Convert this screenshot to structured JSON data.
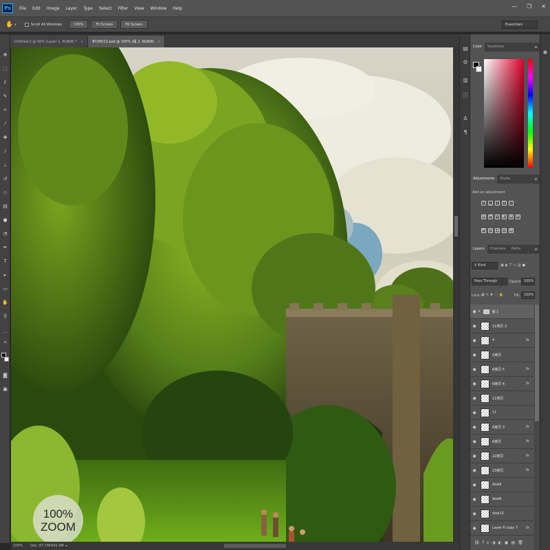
{
  "app": {
    "logo": "Ps"
  },
  "menu": [
    "File",
    "Edit",
    "Image",
    "Layer",
    "Type",
    "Select",
    "Filter",
    "View",
    "Window",
    "Help"
  ],
  "window_controls": {
    "minimize": "—",
    "restore": "❐",
    "close": "✕"
  },
  "options_bar": {
    "tool_icon": "hand-icon",
    "scroll_all_windows": "Scroll All Windows",
    "btn_100": "100%",
    "btn_fit": "Fit Screen",
    "btn_fill": "Fill Screen",
    "workspace": "Essentials"
  },
  "tabs": [
    {
      "label": "Untitled-1 @ 50% (Layer 1, RGB/8) *",
      "close": "×",
      "active": false
    },
    {
      "label": "B7/06/12.psd @ 100% (组 2, RGB/8)",
      "close": "×",
      "active": true
    }
  ],
  "canvas": {
    "overlay_line1": "100%",
    "overlay_line2": "ZOOM"
  },
  "status_bar": {
    "zoom": "100%",
    "doc": "Doc: 87.1M/642.4M"
  },
  "color_panel": {
    "tabs": [
      "Color",
      "Swatches"
    ]
  },
  "adjustments_panel": {
    "tabs": [
      "Adjustments",
      "Styles"
    ],
    "add_label": "Add an adjustment"
  },
  "layers_panel": {
    "tabs": [
      "Layers",
      "Channels",
      "Paths"
    ],
    "filter_kind": "Kind",
    "blend_mode": "Pass Through",
    "opacity_label": "Opacity:",
    "opacity_value": "100%",
    "lock_label": "Lock:",
    "fill_label": "Fill:",
    "fill_value": "100%",
    "layers": [
      {
        "name": "组 1",
        "group": true,
        "fx": ""
      },
      {
        "name": "11拷贝 2",
        "group": false,
        "fx": ""
      },
      {
        "name": "4",
        "group": false,
        "fx": "fx"
      },
      {
        "name": "5拷贝",
        "group": false,
        "fx": ""
      },
      {
        "name": "6拷贝 5",
        "group": false,
        "fx": "fx"
      },
      {
        "name": "6拷贝 4",
        "group": false,
        "fx": "fx"
      },
      {
        "name": "11拷贝",
        "group": false,
        "fx": ""
      },
      {
        "name": "11",
        "group": false,
        "fx": ""
      },
      {
        "name": "6拷贝 3",
        "group": false,
        "fx": "fx"
      },
      {
        "name": "6拷贝",
        "group": false,
        "fx": "fx"
      },
      {
        "name": "22拷贝",
        "group": false,
        "fx": "fx"
      },
      {
        "name": "23拷贝",
        "group": false,
        "fx": "fx"
      },
      {
        "name": "dow6",
        "group": false,
        "fx": ""
      },
      {
        "name": "dow6",
        "group": false,
        "fx": ""
      },
      {
        "name": "dow13",
        "group": false,
        "fx": ""
      },
      {
        "name": "Layer 6 copy 7",
        "group": false,
        "fx": "fx"
      }
    ],
    "bottom_icons": [
      "⛓",
      "fx",
      "◑",
      "◐",
      "▣",
      "▤",
      "🗑"
    ]
  },
  "colors": {
    "menubar": "#535353",
    "panel": "#535353",
    "dark": "#282828",
    "accent": "#31a8ff"
  }
}
